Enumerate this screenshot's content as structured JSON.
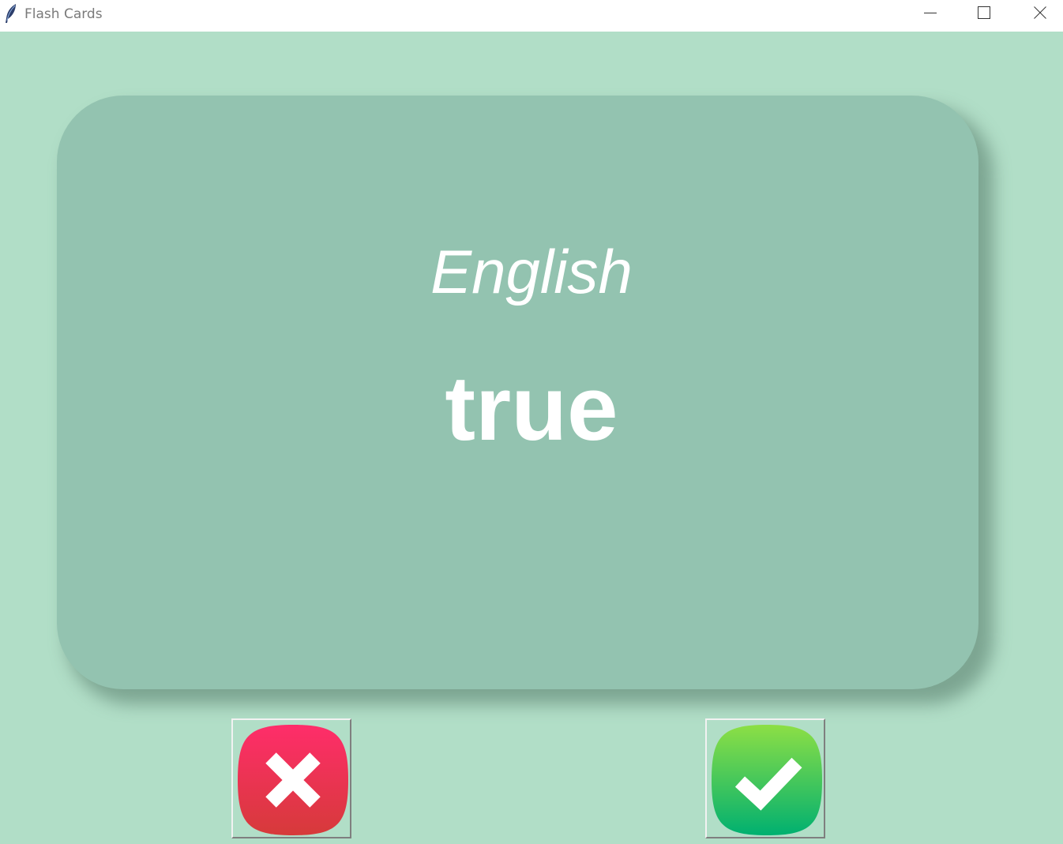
{
  "window": {
    "title": "Flash Cards",
    "app_icon": "feather-icon",
    "controls": [
      "minimize-icon",
      "maximize-icon",
      "close-icon"
    ]
  },
  "card": {
    "language": "English",
    "word": "true"
  },
  "buttons": {
    "wrong_icon": "cross-icon",
    "right_icon": "checkmark-icon"
  },
  "colors": {
    "background": "#b1dec7",
    "card": "#93c3b0",
    "card_text": "#ffffff",
    "wrong_button": "#e8304f",
    "right_button": "#3cc85a"
  }
}
